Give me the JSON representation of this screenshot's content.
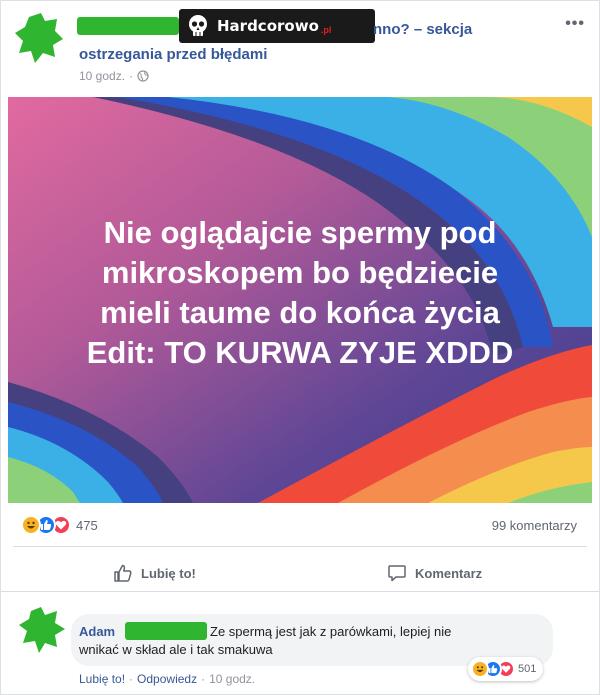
{
  "post": {
    "title_line1_tail": "nno? – sekcja",
    "title_line2": "ostrzegania przed błędami",
    "time": "10 godz.",
    "dot": "·",
    "more_menu": "•••",
    "watermark": {
      "brand": "Hardcorowo",
      "suffix": ".pl"
    },
    "image_text": [
      "Nie oglądajcie spermy pod",
      "mikroskopem bo będziecie",
      "mieli taume do końca życia",
      "Edit: TO KURWA ZYJE XDDD"
    ]
  },
  "stats": {
    "reactions_count": "475",
    "comments_count": "99 komentarzy"
  },
  "actions": {
    "like": "Lubię to!",
    "comment": "Komentarz"
  },
  "comment": {
    "author": "Adam",
    "text_line1": "Ze spermą jest jak z parówkami, lepiej nie",
    "text_line2": "wnikać w skład ale i tak smakuwa",
    "reactions_count": "501",
    "like": "Lubię to!",
    "reply": "Odpowiedz",
    "time": "10 godz."
  },
  "colors": {
    "link": "#365899",
    "redaction": "#2fb52f",
    "like_blue": "#1877f2",
    "love_red": "#f33e58",
    "haha_yellow": "#f7b125"
  },
  "icons": [
    "globe-icon",
    "more-icon",
    "haha-icon",
    "like-icon",
    "love-icon",
    "thumbs-up-icon",
    "comment-icon",
    "skull-icon"
  ]
}
